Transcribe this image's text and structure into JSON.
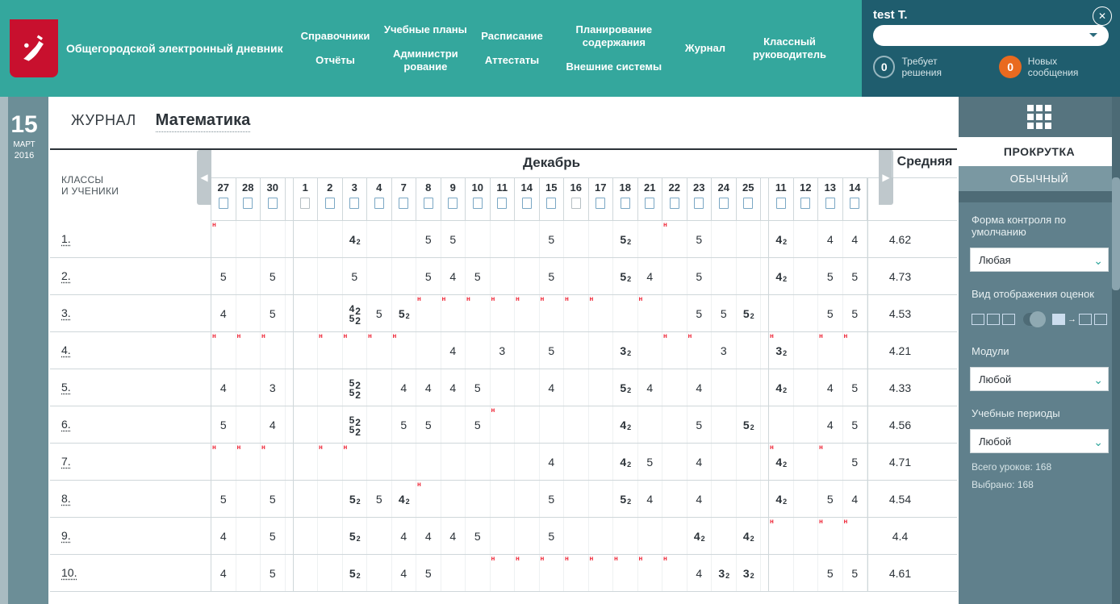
{
  "app": {
    "title": "Общегородской электронный дневник"
  },
  "nav": [
    [
      "Справочники",
      "Отчёты"
    ],
    [
      "Учебные планы",
      "Администри рование"
    ],
    [
      "Расписание",
      "Аттестаты"
    ],
    [
      "Планирование содержания",
      "Внешние системы"
    ],
    [
      "Журнал"
    ],
    [
      "Классный руководитель"
    ]
  ],
  "user": {
    "name": "test T.",
    "badges": [
      {
        "count": "0",
        "label": "Требует решения",
        "style": "grey"
      },
      {
        "count": "0",
        "label": "Новых сообщения",
        "style": "orange"
      }
    ]
  },
  "date": {
    "day": "15",
    "month": "МАРТ",
    "year": "2016"
  },
  "page": {
    "label": "ЖУРНАЛ",
    "subject": "Математика"
  },
  "grid": {
    "students_header": "КЛАССЫ\nИ УЧЕНИКИ",
    "month": "Декабрь",
    "avg_header": "Средняя",
    "days": [
      "27",
      "28",
      "30",
      "",
      "1",
      "2",
      "3",
      "4",
      "7",
      "8",
      "9",
      "10",
      "11",
      "14",
      "15",
      "16",
      "17",
      "18",
      "21",
      "22",
      "23",
      "24",
      "25",
      "",
      "11",
      "12",
      "13",
      "14"
    ],
    "rows": [
      {
        "n": "1.",
        "avg": "4.62",
        "tags": {
          "0": "н",
          "18": "н"
        },
        "cells": {
          "5": [
            "4",
            "2"
          ],
          "8": "5",
          "9": "5",
          "13": "5",
          "16": [
            "5",
            "2"
          ],
          "19": "5",
          "22": [
            "4",
            "2"
          ],
          "24": "4",
          "25": "4",
          "26": "5"
        }
      },
      {
        "n": "2.",
        "avg": "4.73",
        "cells": {
          "0": "5",
          "2": "5",
          "5": "5",
          "8": "5",
          "9": "4",
          "10": "5",
          "13": "5",
          "16": [
            "5",
            "2"
          ],
          "17": "4",
          "19": "5",
          "22": [
            "4",
            "2"
          ],
          "24": "5",
          "25": "5",
          "26": "5"
        }
      },
      {
        "n": "3.",
        "avg": "4.53",
        "tags": {
          "8": "н",
          "9": "н",
          "10": "н",
          "11": "н",
          "12": "н",
          "13": "н",
          "14": "н",
          "15": "н",
          "17": "н"
        },
        "cells": {
          "0": "4",
          "2": "5",
          "5": [
            [
              "4",
              "2"
            ],
            [
              "5",
              "2"
            ]
          ],
          "6": "5",
          "7": [
            "5",
            "2"
          ],
          "19": "5",
          "20": "5",
          "21": [
            "5",
            "2"
          ],
          "24": "5",
          "25": "5",
          "26": "5"
        }
      },
      {
        "n": "4.",
        "avg": "4.21",
        "tags": {
          "0": "н",
          "1": "н",
          "2": "н",
          "4": "н",
          "5": "н",
          "6": "н",
          "7": "н",
          "18": "н",
          "19": "н",
          "22": "н",
          "24": "н",
          "25": "н",
          "26": "н"
        },
        "cells": {
          "9": "4",
          "11": "3",
          "13": "5",
          "16": [
            "3",
            "2"
          ],
          "20": "3",
          "22": [
            "3",
            "2"
          ]
        }
      },
      {
        "n": "5.",
        "avg": "4.33",
        "cells": {
          "0": "4",
          "2": "3",
          "5": [
            [
              "5",
              "2"
            ],
            [
              "5",
              "2"
            ]
          ],
          "7": "4",
          "8": "4",
          "9": "4",
          "10": "5",
          "13": "4",
          "16": [
            "5",
            "2"
          ],
          "17": "4",
          "19": "4",
          "22": [
            "4",
            "2"
          ],
          "24": "4",
          "25": "5",
          "26": "4"
        }
      },
      {
        "n": "6.",
        "avg": "4.56",
        "tags": {
          "11": "н"
        },
        "cells": {
          "0": "5",
          "2": "4",
          "5": [
            [
              "5",
              "2"
            ],
            [
              "5",
              "2"
            ]
          ],
          "7": "5",
          "8": "5",
          "10": "5",
          "16": [
            "4",
            "2"
          ],
          "19": "5",
          "21": [
            "5",
            "2"
          ],
          "24": "4",
          "25": "5",
          "26": "4"
        }
      },
      {
        "n": "7.",
        "avg": "4.71",
        "tags": {
          "0": "н",
          "1": "н",
          "2": "н",
          "4": "н",
          "5": "н",
          "22": "н",
          "24": "н"
        },
        "cells": {
          "13": "4",
          "16": [
            "4",
            "2"
          ],
          "17": "5",
          "19": "4",
          "22": [
            "4",
            "2"
          ],
          "25": "5",
          "26": "5"
        }
      },
      {
        "n": "8.",
        "avg": "4.54",
        "tags": {
          "8": "н"
        },
        "cells": {
          "0": "5",
          "2": "5",
          "5": [
            "5",
            "2"
          ],
          "6": "5",
          "7": [
            "4",
            "2"
          ],
          "13": "5",
          "16": [
            "5",
            "2"
          ],
          "17": "4",
          "19": "4",
          "22": [
            "4",
            "2"
          ],
          "24": "5",
          "25": "4",
          "26": "4"
        }
      },
      {
        "n": "9.",
        "avg": "4.4",
        "tags": {
          "22": "н",
          "24": "н",
          "25": "н",
          "26": "н"
        },
        "cells": {
          "0": "4",
          "2": "5",
          "5": [
            "5",
            "2"
          ],
          "7": "4",
          "8": "4",
          "9": "4",
          "10": "5",
          "13": "5",
          "19": [
            "4",
            "2"
          ],
          "21": [
            "4",
            "2"
          ]
        }
      },
      {
        "n": "10.",
        "avg": "4.61",
        "tags": {
          "11": "н",
          "12": "н",
          "13": "н",
          "14": "н",
          "15": "н",
          "16": "н",
          "17": "н",
          "18": "н"
        },
        "cells": {
          "0": "4",
          "2": "5",
          "5": [
            "5",
            "2"
          ],
          "7": "4",
          "8": "5",
          "19": "4",
          "20": [
            "3",
            "2"
          ],
          "21": [
            "3",
            "2"
          ],
          "24": "5",
          "25": "5",
          "26": "5"
        }
      }
    ]
  },
  "panel": {
    "scroll": "ПРОКРУТКА",
    "mode": "ОБЫЧНЫЙ",
    "control_form_label": "Форма контроля по умолчанию",
    "control_form_value": "Любая",
    "display_label": "Вид отображения оценок",
    "modules_label": "Модули",
    "modules_value": "Любой",
    "periods_label": "Учебные периоды",
    "periods_value": "Любой",
    "stat1": "Всего уроков: 168",
    "stat2": "Выбрано: 168"
  }
}
